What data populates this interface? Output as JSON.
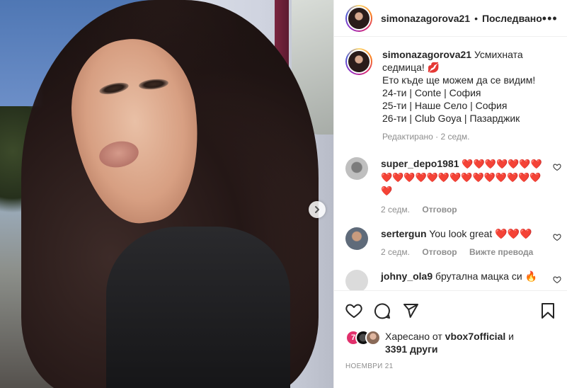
{
  "post": {
    "next_button": "›"
  },
  "header": {
    "username": "simonazagorova21",
    "separator": "•",
    "follow_status": "Последвано",
    "more": "•••"
  },
  "caption": {
    "username": "simonazagorova21",
    "lines": [
      "Усмихната седмица! 💋",
      "Ето къде ще можем да се видим!",
      "24-ти | Conte | София",
      "25-ти | Наше Село | София",
      "26-ти | Club Goya | Пазарджик"
    ],
    "edited": "Редактирано",
    "time": "2 седм."
  },
  "comments": [
    {
      "username": "super_depo1981",
      "text": "❤️❤️❤️❤️❤️❤️❤️❤️❤️❤️❤️❤️❤️❤️❤️❤️❤️❤️❤️❤️❤️❤️",
      "time": "2 седм.",
      "reply": "Отговор"
    },
    {
      "username": "sertergun",
      "text": "You look great ❤️❤️❤️",
      "time": "2 седм.",
      "reply": "Отговор",
      "translate": "Вижте превода"
    },
    {
      "username": "johny_ola9",
      "text": "брутална мацка си 🔥"
    }
  ],
  "actions": {
    "like_icon": "heart-outline-icon",
    "comment_icon": "comment-icon",
    "share_icon": "paper-plane-icon",
    "save_icon": "bookmark-icon"
  },
  "likes": {
    "badge": "7",
    "prefix": "Харесано от",
    "user": "vbox7official",
    "joiner": "и",
    "others": "3391 други"
  },
  "date": "НОЕМВРИ 21",
  "colors": {
    "accent_red": "#ed2b3b",
    "meta_gray": "#8e8e8e",
    "text": "#262626"
  }
}
